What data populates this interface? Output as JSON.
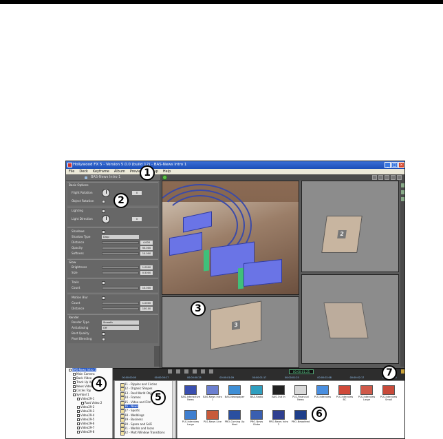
{
  "window": {
    "title": "Hollywood FX 5 - Version 5.0.0 (build 12) - BAS-News Intro 1",
    "controls": [
      "_",
      "□",
      "×"
    ]
  },
  "menu": [
    "File",
    "Deck",
    "Keyframe",
    "Album",
    "Preview",
    "Setup",
    "Help"
  ],
  "document_tab": "BAS-News Intro 1",
  "properties": {
    "basic_options": "Basic Options",
    "flight_rotation": "Flight Rotation",
    "flight_rotation_value": "0",
    "object_rotation": "Object Rotation",
    "lighting": "Lighting",
    "light_direction": "Light Direction",
    "light_direction_value": "0",
    "shadows": "Shadows",
    "shadow_type": "Shadow Type",
    "shadow_type_value": "Drop",
    "distance": "Distance",
    "distance_value": "4.000",
    "opacity": "Opacity",
    "opacity_value": "50.000",
    "softness": "Softness",
    "softness_value": "10.000",
    "glow": "Glow",
    "brightness": "Brightness",
    "brightness_value": "1.0000",
    "size": "Size",
    "size_value": "0.5000",
    "trails": "Trails",
    "count": "Count",
    "count_value": "10.000",
    "motion_blur": "Motion Blur",
    "mb_count": "Count",
    "mb_count_value": "1.0000",
    "mb_distance": "Distance",
    "mb_distance_value": "100.00",
    "render": "Render",
    "render_type": "Render Type",
    "render_type_value": "Smooth",
    "antialiasing": "Antialiasing",
    "antialiasing_value": "Off",
    "best_quality": "Best Quality",
    "pixel_blending": "Pixel Blending"
  },
  "timeline": {
    "timecode": "00:00:01:25",
    "ruler": [
      "00:00:00:00",
      "00:00:00:17",
      "00:00:00:25",
      "00:00:01:09",
      "00:00:01:17",
      "00:00:01:25",
      "00:00:02:08",
      "00:00:02:17",
      "00:00:03:00"
    ]
  },
  "tree": [
    {
      "label": "BAS-News Intro 1",
      "selected": true
    },
    {
      "label": "Main Camera"
    },
    {
      "label": "Back Video"
    },
    {
      "label": "Track Up Video"
    },
    {
      "label": "News Video"
    },
    {
      "label": "Circles Top"
    },
    {
      "label": "Symbol 1"
    },
    {
      "label": "Video29-1"
    },
    {
      "label": "Root Video 2"
    },
    {
      "label": "Video29-2"
    },
    {
      "label": "Video29-3"
    },
    {
      "label": "Video29-4"
    },
    {
      "label": "Video29-5"
    },
    {
      "label": "Video29-6"
    },
    {
      "label": "Video29-7"
    },
    {
      "label": "Video29-8"
    }
  ],
  "categories": [
    {
      "label": "11 - Ripples and Circles"
    },
    {
      "label": "12 - Organic Shapes"
    },
    {
      "label": "13 - Real World Objects"
    },
    {
      "label": "14 - Frames"
    },
    {
      "label": "15 - Video and Film"
    },
    {
      "label": "16 - News",
      "selected": true
    },
    {
      "label": "17 - Sports"
    },
    {
      "label": "18 - Weddings"
    },
    {
      "label": "19 - Business"
    },
    {
      "label": "20 - Space and SciFi"
    },
    {
      "label": "21 - Worlds and Icons"
    },
    {
      "label": "22 - Multi Window Transitions"
    }
  ],
  "thumbnails": [
    {
      "label": "BAS-Interactive News",
      "color": "#3a4fb0"
    },
    {
      "label": "BAS-News Intro 1",
      "color": "#6b7fd0"
    },
    {
      "label": "BAS-Newspaper",
      "color": "#3f8fd6"
    },
    {
      "label": "BAS-Radio",
      "color": "#2f9fc0"
    },
    {
      "label": "BAS-Out In",
      "color": "#222222"
    },
    {
      "label": "PLS-Financial News",
      "color": "#d9d9d9"
    },
    {
      "label": "PLS-Interview",
      "color": "#4a8fe0"
    },
    {
      "label": "PLS-Interview BC",
      "color": "#d04a3a"
    },
    {
      "label": "PLS-Interview Large",
      "color": "#d05a4a"
    },
    {
      "label": "PLS-Interview Small",
      "color": "#c84a3a"
    },
    {
      "label": "PLS-Interview Large",
      "color": "#3f7fd0"
    },
    {
      "label": "PLS-News Line",
      "color": "#c85a3a"
    },
    {
      "label": "PRO-Coming Up Next",
      "color": "#2a4fa0"
    },
    {
      "label": "PRO-News Globe",
      "color": "#3a5fb0"
    },
    {
      "label": "PRO-News Intro 2",
      "color": "#2f3f90"
    },
    {
      "label": "PRO-Newsfeed",
      "color": "#1f3f8a"
    }
  ],
  "callouts": [
    "1",
    "2",
    "3",
    "4",
    "5",
    "6",
    "7"
  ]
}
